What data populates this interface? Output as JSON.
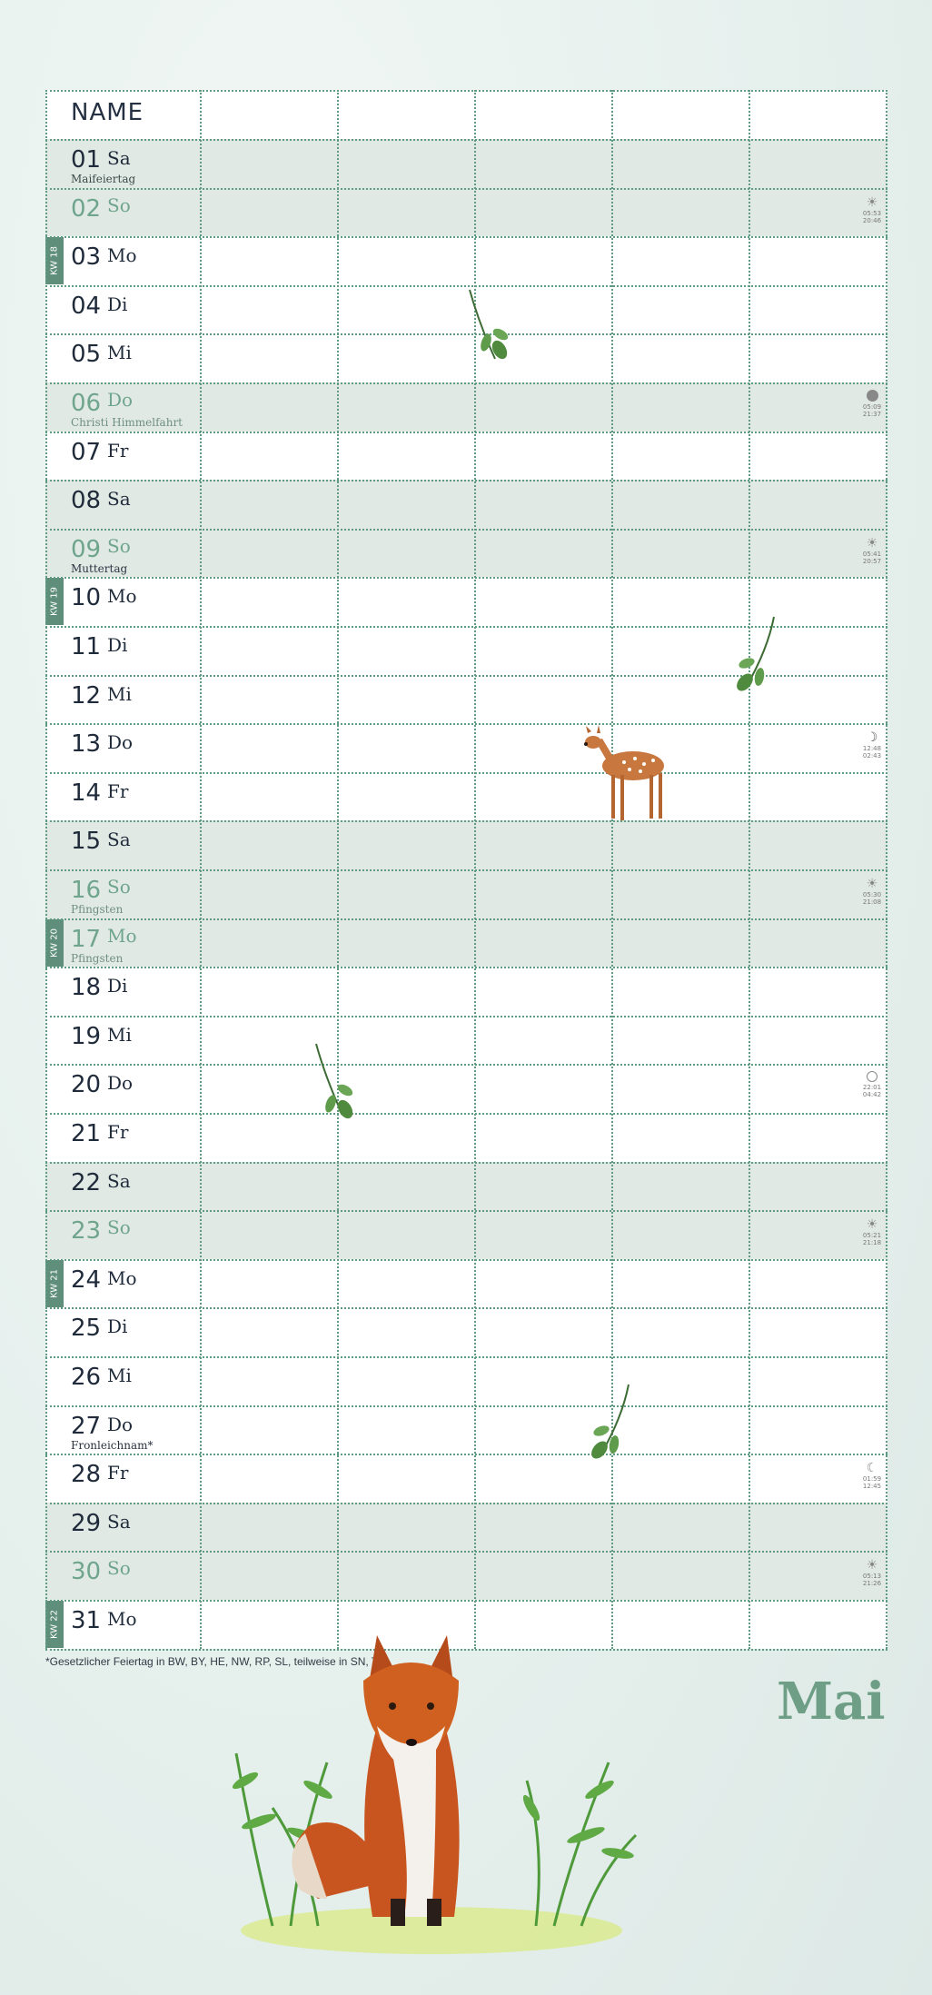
{
  "header": {
    "name_label": "NAME"
  },
  "columns": 6,
  "days": [
    {
      "n": "01",
      "d": "Sa",
      "type": "weekend",
      "holiday": "Maifeiertag"
    },
    {
      "n": "02",
      "d": "So",
      "type": "sunday",
      "info": {
        "icon": "sun-icon",
        "l1": "05:53",
        "l2": "20:46"
      }
    },
    {
      "n": "03",
      "d": "Mo",
      "type": "white",
      "kw": "KW 18"
    },
    {
      "n": "04",
      "d": "Di",
      "type": "white"
    },
    {
      "n": "05",
      "d": "Mi",
      "type": "white"
    },
    {
      "n": "06",
      "d": "Do",
      "type": "sunday",
      "holiday": "Christi Himmelfahrt",
      "info": {
        "icon": "full-moon-icon",
        "l1": "05:09",
        "l2": "21:37"
      }
    },
    {
      "n": "07",
      "d": "Fr",
      "type": "white"
    },
    {
      "n": "08",
      "d": "Sa",
      "type": "weekend"
    },
    {
      "n": "09",
      "d": "So",
      "type": "sunday",
      "holiday": "Muttertag",
      "holiday_dark": true,
      "info": {
        "icon": "sun-icon",
        "l1": "05:41",
        "l2": "20:57"
      }
    },
    {
      "n": "10",
      "d": "Mo",
      "type": "white",
      "kw": "KW 19"
    },
    {
      "n": "11",
      "d": "Di",
      "type": "white"
    },
    {
      "n": "12",
      "d": "Mi",
      "type": "white"
    },
    {
      "n": "13",
      "d": "Do",
      "type": "white",
      "info": {
        "icon": "crescent-moon-icon",
        "l1": "12:48",
        "l2": "02:43"
      }
    },
    {
      "n": "14",
      "d": "Fr",
      "type": "white"
    },
    {
      "n": "15",
      "d": "Sa",
      "type": "weekend"
    },
    {
      "n": "16",
      "d": "So",
      "type": "sunday",
      "holiday": "Pfingsten",
      "info": {
        "icon": "sun-icon",
        "l1": "05:30",
        "l2": "21:08"
      }
    },
    {
      "n": "17",
      "d": "Mo",
      "type": "sunday",
      "holiday": "Pfingsten",
      "kw": "KW 20"
    },
    {
      "n": "18",
      "d": "Di",
      "type": "white"
    },
    {
      "n": "19",
      "d": "Mi",
      "type": "white"
    },
    {
      "n": "20",
      "d": "Do",
      "type": "white",
      "info": {
        "icon": "new-moon-icon",
        "l1": "22:01",
        "l2": "04:42"
      }
    },
    {
      "n": "21",
      "d": "Fr",
      "type": "white"
    },
    {
      "n": "22",
      "d": "Sa",
      "type": "weekend"
    },
    {
      "n": "23",
      "d": "So",
      "type": "sunday",
      "info": {
        "icon": "sun-icon",
        "l1": "05:21",
        "l2": "21:18"
      }
    },
    {
      "n": "24",
      "d": "Mo",
      "type": "white",
      "kw": "KW 21"
    },
    {
      "n": "25",
      "d": "Di",
      "type": "white"
    },
    {
      "n": "26",
      "d": "Mi",
      "type": "white"
    },
    {
      "n": "27",
      "d": "Do",
      "type": "white",
      "holiday": "Fronleichnam*",
      "holiday_dark": true
    },
    {
      "n": "28",
      "d": "Fr",
      "type": "white",
      "info": {
        "icon": "waning-moon-icon",
        "l1": "01:59",
        "l2": "12:45"
      }
    },
    {
      "n": "29",
      "d": "Sa",
      "type": "weekend"
    },
    {
      "n": "30",
      "d": "So",
      "type": "sunday",
      "info": {
        "icon": "sun-icon",
        "l1": "05:13",
        "l2": "21:26"
      }
    },
    {
      "n": "31",
      "d": "Mo",
      "type": "white",
      "kw": "KW 22"
    }
  ],
  "footnote": "*Gesetzlicher Feiertag in BW, BY, HE, NW, RP, SL, teilweise in SN, TH",
  "month": "Mai",
  "colors": {
    "accent": "#6e9f86",
    "dots": "#5f9a82",
    "weekend": "#e1e9e4",
    "kw": "#5f8f7b"
  }
}
